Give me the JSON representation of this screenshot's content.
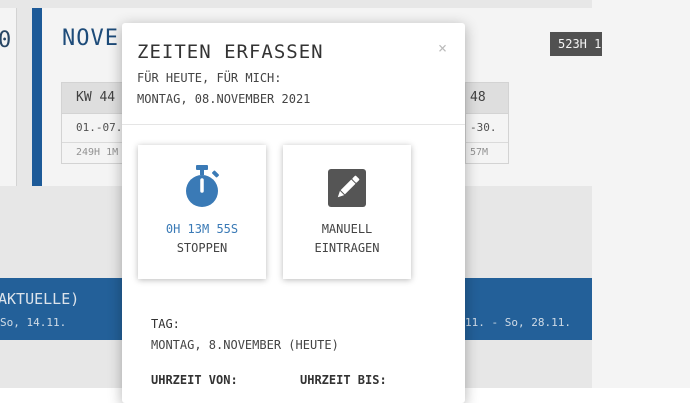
{
  "background": {
    "left_card_fragment": "0",
    "month_title": "NOVE",
    "total_hours": "523H 1",
    "week_first": {
      "header": "KW 44",
      "range": "01.-07.",
      "total": "249H 1M"
    },
    "week_last": {
      "header": "48",
      "range": "-30.",
      "total": "57M"
    },
    "band": {
      "title": "AKTUELLE)",
      "left_range": "So, 14.11.",
      "right_range": "11. - So, 28.11."
    }
  },
  "modal": {
    "title": "ZEITEN ERFASSEN",
    "close_glyph": "×",
    "subtitle": "FÜR HEUTE, FÜR MICH:",
    "date": "MONTAG, 08.NOVEMBER 2021",
    "stop_tile": {
      "time": "0H 13M 55S",
      "label": "STOPPEN",
      "icon": "stopwatch-icon",
      "color": "#3a7ab6"
    },
    "manual_tile": {
      "line1": "MANUELL",
      "line2": "EINTRAGEN",
      "icon": "pencil-icon",
      "color": "#555555"
    },
    "day_label": "TAG:",
    "day_value": "MONTAG, 8.NOVEMBER (HEUTE)",
    "from_label": "UHRZEIT VON:",
    "to_label": "UHRZEIT BIS:"
  },
  "colors": {
    "brand_blue": "#1f5f9f",
    "band_blue": "#2565a0"
  }
}
